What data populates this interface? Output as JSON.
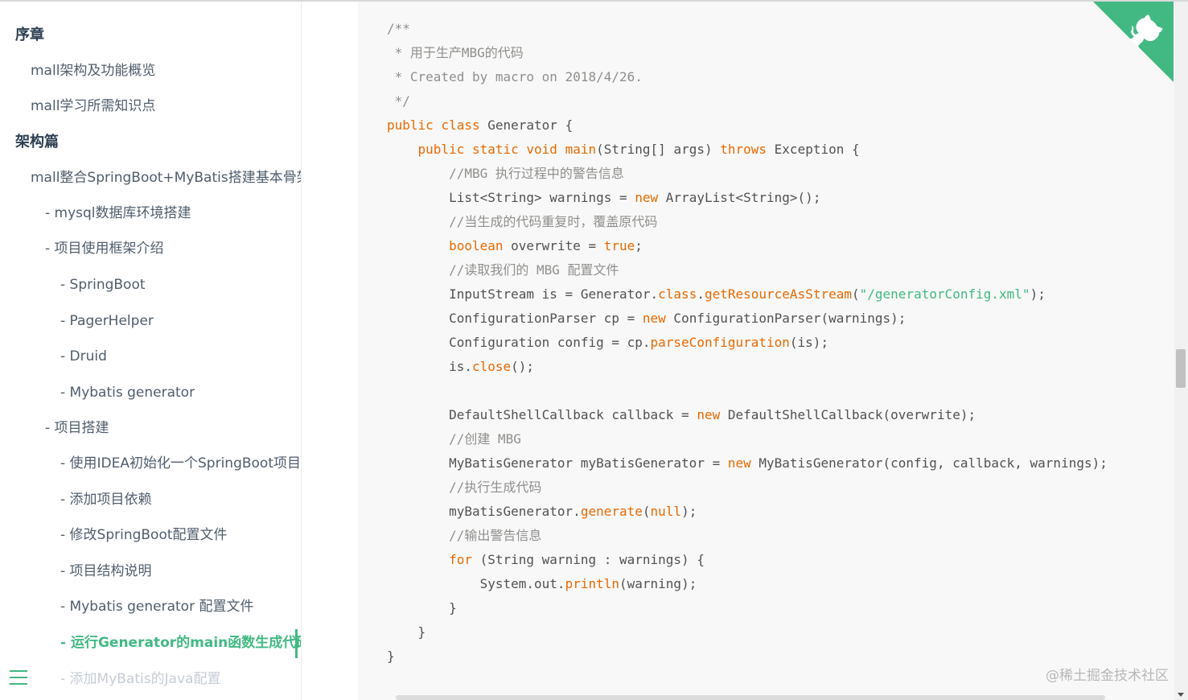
{
  "sidebar": {
    "items": [
      {
        "label": "序章",
        "type": "section"
      },
      {
        "label": "mall架构及功能概览",
        "type": "item"
      },
      {
        "label": "mall学习所需知识点",
        "type": "item"
      },
      {
        "label": "架构篇",
        "type": "section"
      },
      {
        "label": "mall整合SpringBoot+MyBatis搭建基本骨架",
        "type": "item"
      },
      {
        "label": "- mysql数据库环境搭建",
        "type": "sub"
      },
      {
        "label": "- 项目使用框架介绍",
        "type": "sub"
      },
      {
        "label": "- SpringBoot",
        "type": "subsub"
      },
      {
        "label": "- PagerHelper",
        "type": "subsub"
      },
      {
        "label": "- Druid",
        "type": "subsub"
      },
      {
        "label": "- Mybatis generator",
        "type": "subsub"
      },
      {
        "label": "- 项目搭建",
        "type": "sub"
      },
      {
        "label": "- 使用IDEA初始化一个SpringBoot项目",
        "type": "subsub"
      },
      {
        "label": "- 添加项目依赖",
        "type": "subsub"
      },
      {
        "label": "- 修改SpringBoot配置文件",
        "type": "subsub"
      },
      {
        "label": "- 项目结构说明",
        "type": "subsub"
      },
      {
        "label": "- Mybatis generator 配置文件",
        "type": "subsub"
      },
      {
        "label": "- 运行Generator的main函数生成代码",
        "type": "subsub",
        "active": true
      },
      {
        "label": "- 添加MyBatis的Java配置",
        "type": "subsub",
        "faded": true
      }
    ]
  },
  "code": {
    "lines": [
      [
        [
          "cm",
          "/**"
        ]
      ],
      [
        [
          "cm",
          " * 用于生产MBG的代码"
        ]
      ],
      [
        [
          "cm",
          " * Created by macro on 2018/4/26."
        ]
      ],
      [
        [
          "cm",
          " */"
        ]
      ],
      [
        [
          "kw",
          "public"
        ],
        [
          "pl",
          " "
        ],
        [
          "kw",
          "class"
        ],
        [
          "pl",
          " Generator {"
        ]
      ],
      [
        [
          "pl",
          "    "
        ],
        [
          "kw",
          "public"
        ],
        [
          "pl",
          " "
        ],
        [
          "kw",
          "static"
        ],
        [
          "pl",
          " "
        ],
        [
          "kw",
          "void"
        ],
        [
          "pl",
          " "
        ],
        [
          "fn",
          "main"
        ],
        [
          "pl",
          "(String[] args) "
        ],
        [
          "kw",
          "throws"
        ],
        [
          "pl",
          " Exception {"
        ]
      ],
      [
        [
          "pl",
          "        "
        ],
        [
          "cm",
          "//MBG 执行过程中的警告信息"
        ]
      ],
      [
        [
          "pl",
          "        List<String> warnings = "
        ],
        [
          "kw",
          "new"
        ],
        [
          "pl",
          " ArrayList<String>();"
        ]
      ],
      [
        [
          "pl",
          "        "
        ],
        [
          "cm",
          "//当生成的代码重复时，覆盖原代码"
        ]
      ],
      [
        [
          "pl",
          "        "
        ],
        [
          "kw",
          "boolean"
        ],
        [
          "pl",
          " overwrite = "
        ],
        [
          "kw",
          "true"
        ],
        [
          "pl",
          ";"
        ]
      ],
      [
        [
          "pl",
          "        "
        ],
        [
          "cm",
          "//读取我们的 MBG 配置文件"
        ]
      ],
      [
        [
          "pl",
          "        InputStream is = Generator."
        ],
        [
          "kw",
          "class"
        ],
        [
          "pl",
          "."
        ],
        [
          "fn",
          "getResourceAsStream"
        ],
        [
          "pl",
          "("
        ],
        [
          "str",
          "\"/generatorConfig.xml\""
        ],
        [
          "pl",
          ");"
        ]
      ],
      [
        [
          "pl",
          "        ConfigurationParser cp = "
        ],
        [
          "kw",
          "new"
        ],
        [
          "pl",
          " ConfigurationParser(warnings);"
        ]
      ],
      [
        [
          "pl",
          "        Configuration config = cp."
        ],
        [
          "fn",
          "parseConfiguration"
        ],
        [
          "pl",
          "(is);"
        ]
      ],
      [
        [
          "pl",
          "        is."
        ],
        [
          "fn",
          "close"
        ],
        [
          "pl",
          "();"
        ]
      ],
      [
        [
          "pl",
          ""
        ]
      ],
      [
        [
          "pl",
          "        DefaultShellCallback callback = "
        ],
        [
          "kw",
          "new"
        ],
        [
          "pl",
          " DefaultShellCallback(overwrite);"
        ]
      ],
      [
        [
          "pl",
          "        "
        ],
        [
          "cm",
          "//创建 MBG"
        ]
      ],
      [
        [
          "pl",
          "        MyBatisGenerator myBatisGenerator = "
        ],
        [
          "kw",
          "new"
        ],
        [
          "pl",
          " MyBatisGenerator(config, callback, warnings);"
        ]
      ],
      [
        [
          "pl",
          "        "
        ],
        [
          "cm",
          "//执行生成代码"
        ]
      ],
      [
        [
          "pl",
          "        myBatisGenerator."
        ],
        [
          "fn",
          "generate"
        ],
        [
          "pl",
          "("
        ],
        [
          "kw",
          "null"
        ],
        [
          "pl",
          ");"
        ]
      ],
      [
        [
          "pl",
          "        "
        ],
        [
          "cm",
          "//输出警告信息"
        ]
      ],
      [
        [
          "pl",
          "        "
        ],
        [
          "kw",
          "for"
        ],
        [
          "pl",
          " (String warning : warnings) {"
        ]
      ],
      [
        [
          "pl",
          "            System.out."
        ],
        [
          "fn",
          "println"
        ],
        [
          "pl",
          "(warning);"
        ]
      ],
      [
        [
          "pl",
          "        }"
        ]
      ],
      [
        [
          "pl",
          "    }"
        ]
      ],
      [
        [
          "pl",
          "}"
        ]
      ]
    ]
  },
  "watermark": "@稀土掘金技术社区",
  "icons": {
    "github_corner": "github-octocat-icon",
    "menu": "hamburger-menu-icon"
  },
  "colors": {
    "accent": "#42b983",
    "keyword": "#e96900",
    "string": "#42b983",
    "comment": "#8e908c",
    "code_bg": "#f8f8f8"
  }
}
